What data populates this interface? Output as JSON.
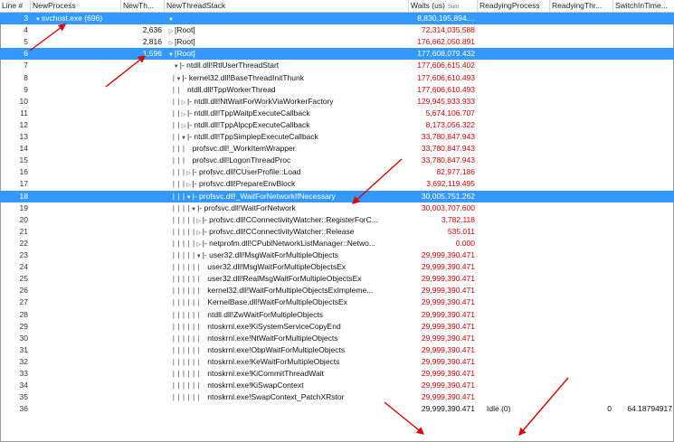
{
  "columns": {
    "line": "Line #",
    "process": "NewProcess",
    "new_thread": "NewTh...",
    "stack": "NewThreadStack",
    "waits": "Waits (us)",
    "waits_sub": "Sum",
    "ready_process": "ReadyingProcess",
    "ready_thread": "ReadyingThr...",
    "switch_time": "SwitchInTime..."
  },
  "rows": [
    {
      "line": "3",
      "process": "svchost.exe (696)",
      "newth": "",
      "indent": "",
      "tri": "down",
      "stack": "",
      "waits": "8,830,195,894....",
      "ready": "",
      "readyth": "",
      "switch": "",
      "selected": true,
      "proc_tri": true
    },
    {
      "line": "4",
      "process": "",
      "newth": "2,636",
      "indent": "",
      "tri": "right",
      "stack": "[Root]",
      "waits": "72,314,035.588",
      "ready": "",
      "readyth": "",
      "switch": ""
    },
    {
      "line": "5",
      "process": "",
      "newth": "2,816",
      "indent": "",
      "tri": "right",
      "stack": "[Root]",
      "waits": "176,662,050.891",
      "ready": "",
      "readyth": "",
      "switch": ""
    },
    {
      "line": "6",
      "process": "",
      "newth": "1,596",
      "indent": "",
      "tri": "down",
      "stack": "[Root]",
      "waits": "177,608,079.432",
      "ready": "",
      "readyth": "",
      "switch": "",
      "selected": true
    },
    {
      "line": "7",
      "process": "",
      "newth": "",
      "indent": "  ",
      "tri": "down",
      "stack": "|- ntdll.dll!RtlUserThreadStart",
      "waits": "177,606,615.402",
      "ready": "",
      "readyth": "",
      "switch": ""
    },
    {
      "line": "8",
      "process": "",
      "newth": "",
      "indent": "  |",
      "tri": "down",
      "stack": "|- kernel32.dll!BaseThreadInitThunk",
      "waits": "177,606,610.493",
      "ready": "",
      "readyth": "",
      "switch": ""
    },
    {
      "line": "9",
      "process": "",
      "newth": "",
      "indent": "  | |",
      "tri": "",
      "stack": "ntdll.dll!TppWorkerThread",
      "waits": "177,606,610.493",
      "ready": "",
      "readyth": "",
      "switch": ""
    },
    {
      "line": "10",
      "process": "",
      "newth": "",
      "indent": "  | |",
      "tri": "right",
      "stack": "|- ntdll.dll!NtWaitForWorkViaWorkerFactory",
      "waits": "129,945,933.933",
      "ready": "",
      "readyth": "",
      "switch": ""
    },
    {
      "line": "11",
      "process": "",
      "newth": "",
      "indent": "  | |",
      "tri": "right",
      "stack": "|- ntdll.dll!TppWaitpExecuteCallback",
      "waits": "5,674,106.707",
      "ready": "",
      "readyth": "",
      "switch": ""
    },
    {
      "line": "12",
      "process": "",
      "newth": "",
      "indent": "  | |",
      "tri": "right",
      "stack": "|- ntdll.dll!TppAlpcpExecuteCallback",
      "waits": "8,173,056.322",
      "ready": "",
      "readyth": "",
      "switch": ""
    },
    {
      "line": "13",
      "process": "",
      "newth": "",
      "indent": "  | |",
      "tri": "down",
      "stack": "|- ntdll.dll!TppSimplepExecuteCallback",
      "waits": "33,780,847.943",
      "ready": "",
      "readyth": "",
      "switch": ""
    },
    {
      "line": "14",
      "process": "",
      "newth": "",
      "indent": "  | | |",
      "tri": "",
      "stack": "profsvc.dll!_WorkItemWrapper",
      "waits": "33,780,847.943",
      "ready": "",
      "readyth": "",
      "switch": ""
    },
    {
      "line": "15",
      "process": "",
      "newth": "",
      "indent": "  | | |",
      "tri": "",
      "stack": "profsvc.dll!LogonThreadProc",
      "waits": "33,780,847.943",
      "ready": "",
      "readyth": "",
      "switch": ""
    },
    {
      "line": "16",
      "process": "",
      "newth": "",
      "indent": "  | | |",
      "tri": "right",
      "stack": "|- profsvc.dll!CUserProfile::Load",
      "waits": "82,977.186",
      "ready": "",
      "readyth": "",
      "switch": ""
    },
    {
      "line": "17",
      "process": "",
      "newth": "",
      "indent": "  | | |",
      "tri": "right",
      "stack": "|- profsvc.dll!PrepareEnvBlock",
      "waits": "3,692,119.495",
      "ready": "",
      "readyth": "",
      "switch": ""
    },
    {
      "line": "18",
      "process": "",
      "newth": "",
      "indent": "  | | |",
      "tri": "down",
      "stack": "|- profsvc.dll!_WaitForNetworkIfNecessary",
      "waits": "30,005,751.262",
      "ready": "",
      "readyth": "",
      "switch": "",
      "selected": true
    },
    {
      "line": "19",
      "process": "",
      "newth": "",
      "indent": "  | | | |",
      "tri": "down",
      "stack": "|- profsvc.dll!WaitForNetwork",
      "waits": "30,003,707.600",
      "ready": "",
      "readyth": "",
      "switch": ""
    },
    {
      "line": "20",
      "process": "",
      "newth": "",
      "indent": "  | | | | |",
      "tri": "right",
      "stack": "|- profsvc.dll!CConnectivityWatcher::RegisterForC...",
      "waits": "3,782.118",
      "ready": "",
      "readyth": "",
      "switch": ""
    },
    {
      "line": "21",
      "process": "",
      "newth": "",
      "indent": "  | | | | |",
      "tri": "right",
      "stack": "|- profsvc.dll!CConnectivityWatcher::Release",
      "waits": "535.011",
      "ready": "",
      "readyth": "",
      "switch": ""
    },
    {
      "line": "22",
      "process": "",
      "newth": "",
      "indent": "  | | | | |",
      "tri": "right",
      "stack": "|- netprofm.dll!CPublNetworkListManager::Netwo...",
      "waits": "0.000",
      "ready": "",
      "readyth": "",
      "switch": ""
    },
    {
      "line": "23",
      "process": "",
      "newth": "",
      "indent": "  | | | | |",
      "tri": "down",
      "stack": "|- user32.dll!MsgWaitForMultipleObjects",
      "waits": "29,999,390.471",
      "ready": "",
      "readyth": "",
      "switch": ""
    },
    {
      "line": "24",
      "process": "",
      "newth": "",
      "indent": "  | | | | | |",
      "tri": "",
      "stack": "user32.dll!MsgWaitForMultipleObjectsEx",
      "waits": "29,999,390.471",
      "ready": "",
      "readyth": "",
      "switch": ""
    },
    {
      "line": "25",
      "process": "",
      "newth": "",
      "indent": "  | | | | | |",
      "tri": "",
      "stack": "user32.dll!RealMsgWaitForMultipleObjectsEx",
      "waits": "29,999,390.471",
      "ready": "",
      "readyth": "",
      "switch": ""
    },
    {
      "line": "26",
      "process": "",
      "newth": "",
      "indent": "  | | | | | |",
      "tri": "",
      "stack": "kernel32.dll!WaitForMultipleObjectsExImpleme...",
      "waits": "29,999,390.471",
      "ready": "",
      "readyth": "",
      "switch": ""
    },
    {
      "line": "27",
      "process": "",
      "newth": "",
      "indent": "  | | | | | |",
      "tri": "",
      "stack": "KernelBase.dll!WaitForMultipleObjectsEx",
      "waits": "29,999,390.471",
      "ready": "",
      "readyth": "",
      "switch": ""
    },
    {
      "line": "28",
      "process": "",
      "newth": "",
      "indent": "  | | | | | |",
      "tri": "",
      "stack": "ntdll.dll!ZwWaitForMultipleObjects",
      "waits": "29,999,390.471",
      "ready": "",
      "readyth": "",
      "switch": ""
    },
    {
      "line": "29",
      "process": "",
      "newth": "",
      "indent": "  | | | | | |",
      "tri": "",
      "stack": "ntoskrnl.exe!KiSystemServiceCopyEnd",
      "waits": "29,999,390.471",
      "ready": "",
      "readyth": "",
      "switch": ""
    },
    {
      "line": "30",
      "process": "",
      "newth": "",
      "indent": "  | | | | | |",
      "tri": "",
      "stack": "ntoskrnl.exe!NtWaitForMultipleObjects",
      "waits": "29,999,390.471",
      "ready": "",
      "readyth": "",
      "switch": ""
    },
    {
      "line": "31",
      "process": "",
      "newth": "",
      "indent": "  | | | | | |",
      "tri": "",
      "stack": "ntoskrnl.exe!ObpWaitForMultipleObjects",
      "waits": "29,999,390.471",
      "ready": "",
      "readyth": "",
      "switch": ""
    },
    {
      "line": "32",
      "process": "",
      "newth": "",
      "indent": "  | | | | | |",
      "tri": "",
      "stack": "ntoskrnl.exe!KeWaitForMultipleObjects",
      "waits": "29,999,390.471",
      "ready": "",
      "readyth": "",
      "switch": ""
    },
    {
      "line": "33",
      "process": "",
      "newth": "",
      "indent": "  | | | | | |",
      "tri": "",
      "stack": "ntoskrnl.exe!KiCommitThreadWait",
      "waits": "29,999,390.471",
      "ready": "",
      "readyth": "",
      "switch": ""
    },
    {
      "line": "34",
      "process": "",
      "newth": "",
      "indent": "  | | | | | |",
      "tri": "",
      "stack": "ntoskrnl.exe!KiSwapContext",
      "waits": "29,999,390.471",
      "ready": "",
      "readyth": "",
      "switch": ""
    },
    {
      "line": "35",
      "process": "",
      "newth": "",
      "indent": "  | | | | | |",
      "tri": "",
      "stack": "ntoskrnl.exe!SwapContext_PatchXRstor",
      "waits": "29,999,390.471",
      "ready": "",
      "readyth": "",
      "switch": ""
    },
    {
      "line": "36",
      "process": "",
      "newth": "",
      "indent": "",
      "tri": "",
      "stack": "",
      "waits": "29,999,390.471",
      "ready": "Idle (0)",
      "readyth": "0",
      "switch": "64.18794917",
      "black": true
    }
  ],
  "colors": {
    "selection": "#3399ff",
    "waits_text": "#d40000",
    "arrow": "#e00000"
  },
  "icons": {
    "expand": "triangle-down-icon",
    "collapsed": "triangle-right-icon"
  }
}
